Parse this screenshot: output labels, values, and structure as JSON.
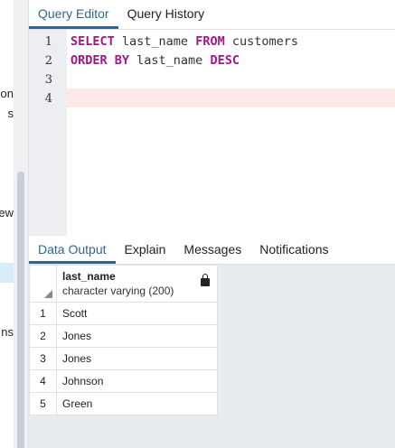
{
  "sidebar": {
    "fragments": [
      "ion",
      "s",
      "ew",
      "ns"
    ]
  },
  "editor_tabs": [
    "Query Editor",
    "Query History"
  ],
  "editor": {
    "lines": [
      {
        "n": "1",
        "parts": [
          [
            "kw",
            "SELECT"
          ],
          [
            "t",
            " last_name "
          ],
          [
            "kw",
            "FROM"
          ],
          [
            "t",
            " customers"
          ]
        ]
      },
      {
        "n": "2",
        "parts": [
          [
            "kw",
            "ORDER BY"
          ],
          [
            "t",
            " last_name "
          ],
          [
            "kw",
            "DESC"
          ]
        ]
      },
      {
        "n": "3",
        "parts": []
      },
      {
        "n": "4",
        "parts": []
      }
    ]
  },
  "output_tabs": [
    "Data Output",
    "Explain",
    "Messages",
    "Notifications"
  ],
  "grid": {
    "column": {
      "name": "last_name",
      "type": "character varying (200)"
    },
    "rows": [
      [
        "1",
        "Scott"
      ],
      [
        "2",
        "Jones"
      ],
      [
        "3",
        "Jones"
      ],
      [
        "4",
        "Johnson"
      ],
      [
        "5",
        "Green"
      ]
    ]
  }
}
